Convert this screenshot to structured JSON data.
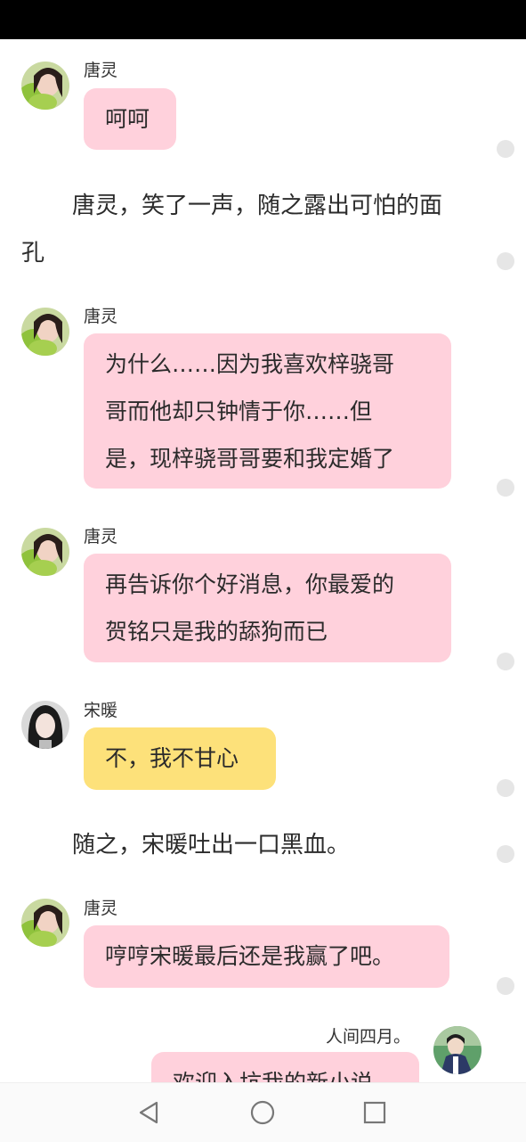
{
  "messages": [
    {
      "speaker": "唐灵",
      "text": "呵呵"
    },
    {
      "narration": "唐灵，笑了一声，随之露出可怕的面孔",
      "line1": "唐灵，笑了一声，随之露出可怕的面",
      "line2": "孔"
    },
    {
      "speaker": "唐灵",
      "lines": [
        "为什么……因为我喜欢梓骁哥",
        "哥而他却只钟情于你……但",
        "是，现梓骁哥哥要和我定婚了"
      ]
    },
    {
      "speaker": "唐灵",
      "lines": [
        "再告诉你个好消息，你最爱的",
        "贺铭只是我的舔狗而已"
      ]
    },
    {
      "speaker": "宋暖",
      "text": "不，我不甘心"
    },
    {
      "narration": "随之，宋暖吐出一口黑血。"
    },
    {
      "speaker": "唐灵",
      "text": "哼哼宋暖最后还是我赢了吧。"
    },
    {
      "speaker": "人间四月。",
      "text": "欢迎入坑我的新小说"
    }
  ],
  "colors": {
    "bubble_pink": "#ffd1dc",
    "bubble_yellow": "#fde17a",
    "status_bar": "#000000",
    "nav_bar": "#fafafa"
  },
  "nav": {
    "back_icon": "triangle-back-icon",
    "home_icon": "circle-home-icon",
    "recents_icon": "square-recents-icon"
  }
}
